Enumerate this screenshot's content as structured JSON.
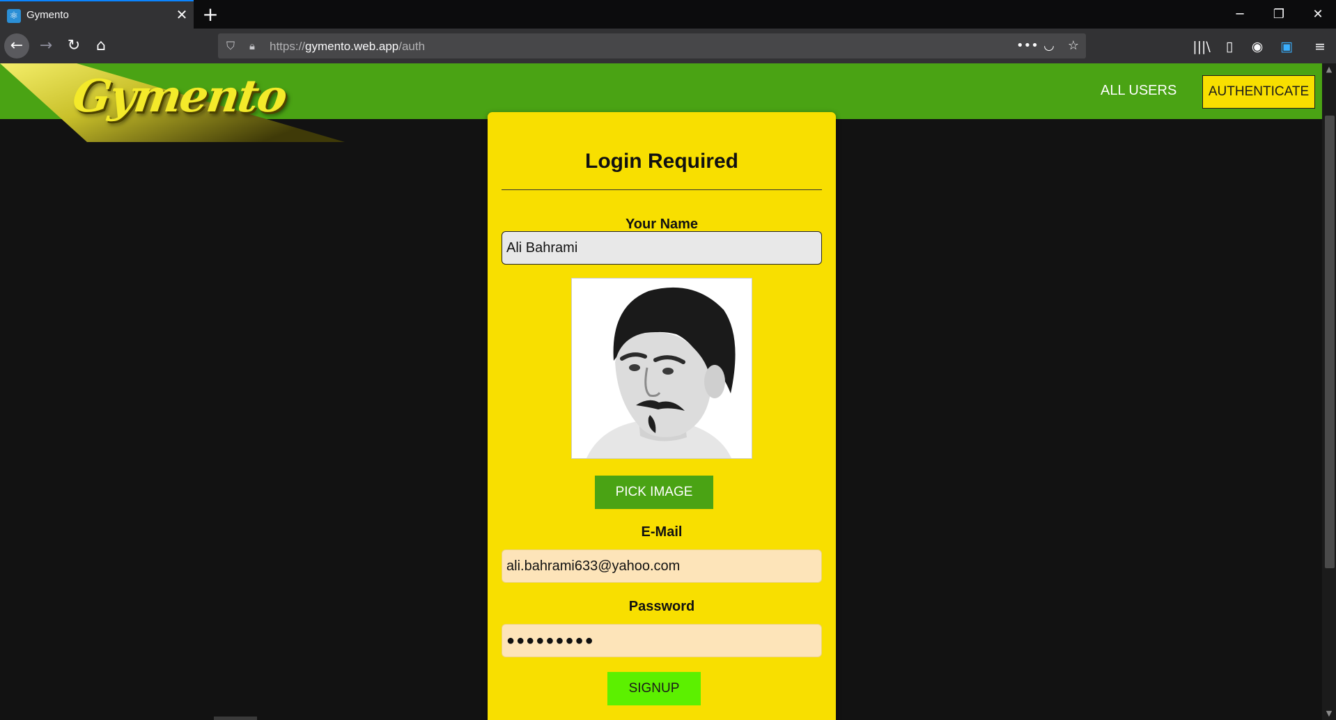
{
  "browser": {
    "tab_title": "Gymento",
    "tab_close": "✕",
    "new_tab": "+",
    "url_scheme": "https://",
    "url_host": "gymento.web.app",
    "url_path": "/auth",
    "icons": {
      "back": "back-arrow-icon",
      "forward": "forward-arrow-icon",
      "reload": "reload-icon",
      "home": "home-icon",
      "shield": "tracking-protection-icon",
      "lock": "lock-icon",
      "more": "page-actions-icon",
      "pocket": "pocket-icon",
      "bookmark": "bookmark-star-icon",
      "library": "library-icon",
      "sidebar": "sidebar-icon",
      "account": "account-icon",
      "extension": "extension-icon",
      "menu": "hamburger-menu-icon"
    },
    "window_controls": {
      "minimize": "─",
      "restore": "❐",
      "close": "✕"
    }
  },
  "header": {
    "logo_text": "Gymento",
    "nav_all_users": "ALL USERS",
    "nav_authenticate": "AUTHENTICATE"
  },
  "auth_card": {
    "title": "Login Required",
    "name_label": "Your Name",
    "name_value": "Ali Bahrami",
    "pick_image_label": "PICK IMAGE",
    "email_label": "E-Mail",
    "email_value": "ali.bahrami633@yahoo.com",
    "password_label": "Password",
    "password_value": "●●●●●●●●●",
    "signup_label": "SIGNUP"
  },
  "colors": {
    "header_green": "#4aa314",
    "card_yellow": "#f8df00",
    "signup_green": "#5cf000",
    "input_peach": "#fde4b9",
    "page_bg": "#121212"
  }
}
